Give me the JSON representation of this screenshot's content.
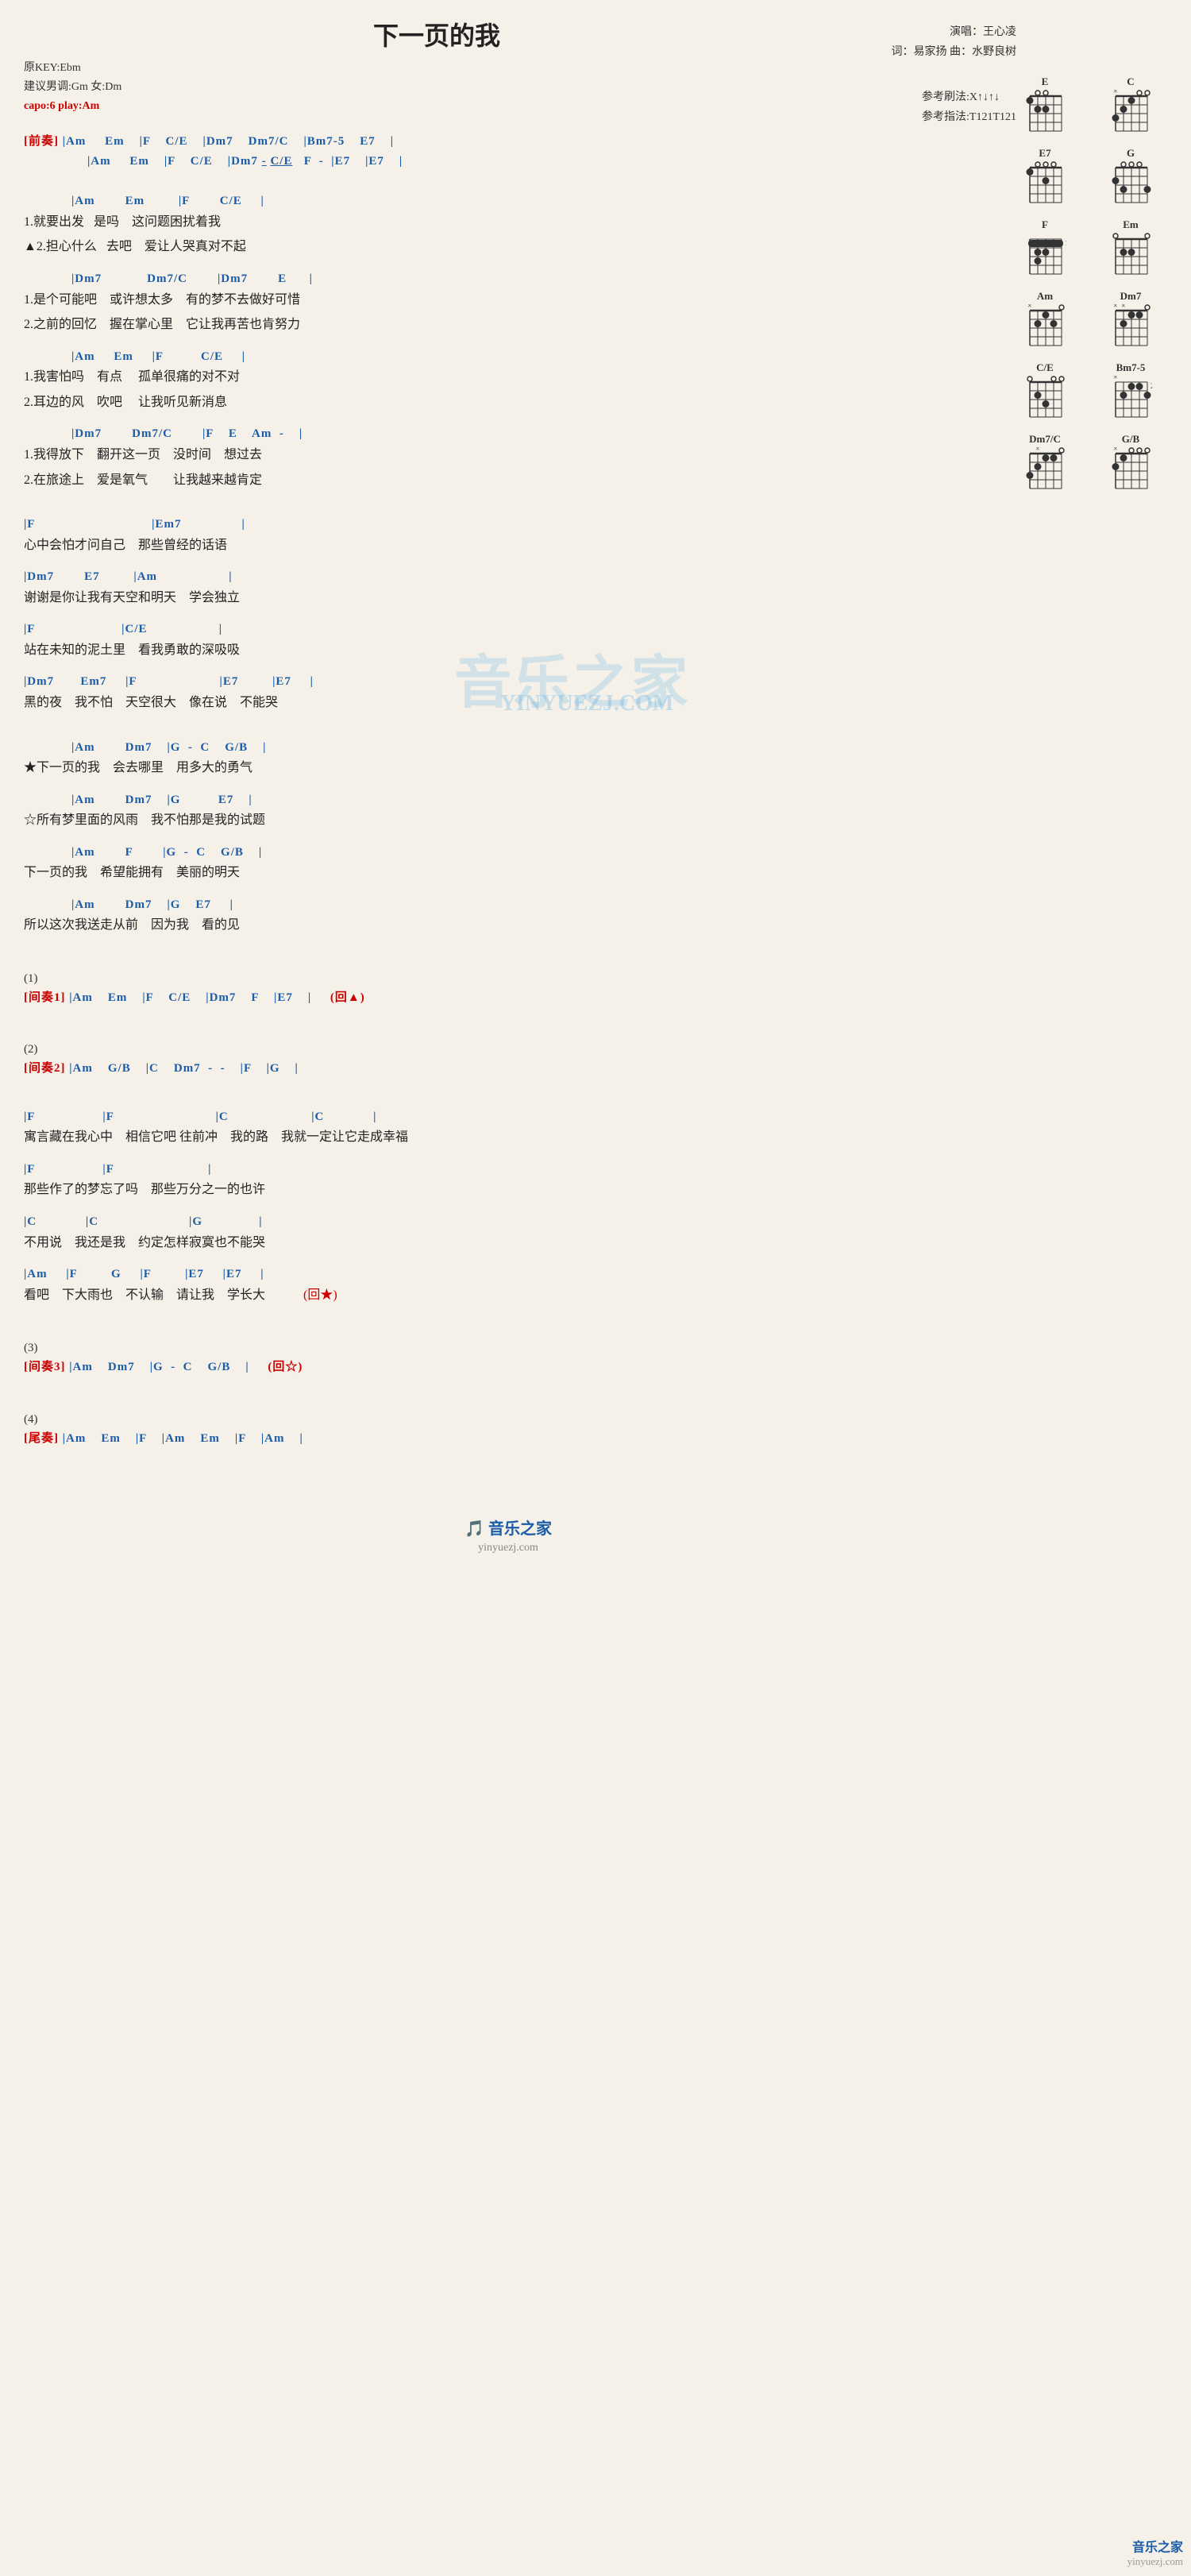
{
  "title": "下一页的我",
  "meta": {
    "original_key": "原KEY:Ebm",
    "suggested": "建议男调:Gm 女:Dm",
    "capo": "capo:6 play:Am",
    "artist_label": "演唱：王心凌",
    "lyrics_label": "词：易家扬  曲：水野良树"
  },
  "ref": {
    "strumming": "参考刷法:X↑↓↑↓",
    "fingering": "参考指法:T121T121"
  },
  "intro1_label": "前奏",
  "chords": {
    "diagrams": [
      {
        "name": "E",
        "pos": 0,
        "dots": [
          [
            1,
            1
          ],
          [
            2,
            2
          ],
          [
            3,
            2
          ]
        ]
      },
      {
        "name": "C",
        "pos": 0,
        "dots": [
          [
            1,
            1
          ],
          [
            2,
            2
          ],
          [
            3,
            3
          ]
        ]
      },
      {
        "name": "E7",
        "pos": 0,
        "dots": [
          [
            1,
            1
          ],
          [
            2,
            0
          ],
          [
            3,
            0
          ]
        ]
      },
      {
        "name": "G",
        "pos": 0,
        "dots": [
          [
            2,
            1
          ],
          [
            3,
            2
          ],
          [
            4,
            3
          ]
        ]
      },
      {
        "name": "F",
        "pos": 0,
        "dots": [
          [
            1,
            1
          ],
          [
            2,
            1
          ],
          [
            3,
            2
          ]
        ]
      },
      {
        "name": "Em",
        "pos": 0,
        "dots": [
          [
            2,
            2
          ],
          [
            3,
            2
          ]
        ]
      },
      {
        "name": "Am",
        "pos": 0,
        "dots": [
          [
            2,
            1
          ],
          [
            3,
            2
          ]
        ]
      },
      {
        "name": "Dm7",
        "pos": 0,
        "dots": [
          [
            1,
            1
          ],
          [
            2,
            1
          ],
          [
            3,
            2
          ]
        ]
      },
      {
        "name": "C/E",
        "pos": 0,
        "dots": [
          [
            2,
            2
          ],
          [
            3,
            3
          ]
        ]
      },
      {
        "name": "Bm7-5",
        "pos": 0,
        "dots": [
          [
            1,
            1
          ],
          [
            2,
            1
          ],
          [
            3,
            2
          ],
          [
            4,
            2
          ]
        ]
      },
      {
        "name": "Dm7/C",
        "pos": 0,
        "dots": [
          [
            1,
            1
          ],
          [
            2,
            1
          ],
          [
            3,
            2
          ]
        ]
      },
      {
        "name": "G/B",
        "pos": 0,
        "dots": [
          [
            1,
            2
          ],
          [
            2,
            0
          ],
          [
            3,
            0
          ]
        ]
      }
    ]
  },
  "sections": [
    {
      "id": "intro1",
      "chord_lines": [
        "|Am    Em    |F    C/E    |Dm7    Dm7/C    |Bm7-5    E7    |",
        "    |Am    Em    |F    C/E    |Dm7  -  C/E  F  -  |E7    |E7    |"
      ]
    },
    {
      "id": "verse1",
      "chord_line": "|Am        Em        |F        C/E    |",
      "lyric_lines": [
        "1.就要出发   是吗    这问题困扰着我",
        "▲2.担心什么   去吧    爱让人哭真对不起"
      ]
    },
    {
      "id": "verse2",
      "chord_line": "    |Dm7            Dm7/C        |Dm7        E    |",
      "lyric_lines": [
        "1.是个可能吧    或许想太多    有的梦不去做好可惜",
        "2.之前的回忆    握在掌心里    它让我再苦也肯努力"
      ]
    },
    {
      "id": "verse3",
      "chord_line": "    |Am    Em    |F        C/E    |",
      "lyric_lines": [
        "1.我害怕吗    有点    孤单很痛的对不对",
        "2.耳边的风    吹吧    让我听见新消息"
      ]
    },
    {
      "id": "verse4",
      "chord_line": "    |Dm7        Dm7/C        |F    E    Am  -  |",
      "lyric_lines": [
        "1.我得放下    翻开这一页    没时间    想过去",
        "2.在旅途上    爱是氧气        让我越来越肯定"
      ]
    },
    {
      "id": "chorus_pre",
      "chord_line": "|F                        |Em7            |",
      "lyric_lines": [
        "心中会怕才问自己    那些曾经的话语"
      ]
    },
    {
      "id": "chorus_pre2",
      "chord_line": "|Dm7        E7        |Am                |",
      "lyric_lines": [
        "谢谢是你让我有天空和明天    学会独立"
      ]
    },
    {
      "id": "chorus_pre3",
      "chord_line": "|F                    |C/E                |",
      "lyric_lines": [
        "站在未知的泥土里    看我勇敢的深吸吸"
      ]
    },
    {
      "id": "chorus_pre4",
      "chord_line": "|Dm7        Em7    |F                    |E7        |E7    |",
      "lyric_lines": [
        "黑的夜    我不怕    天空很大    像在说    不能哭"
      ]
    },
    {
      "id": "chorus_main",
      "chord_line": "    |Am        Dm7    |G  -  C    G/B    |",
      "lyric_lines": [
        "★下一页的我    会去哪里    用多大的勇气"
      ]
    },
    {
      "id": "chorus_main2",
      "chord_line": "    |Am        Dm7    |G        E7    |",
      "lyric_lines": [
        "☆所有梦里面的风雨    我不怕那是我的试题"
      ]
    },
    {
      "id": "chorus_main3",
      "chord_line": "    |Am        F        |G  -  C    G/B    |",
      "lyric_lines": [
        "下一页的我    希望能拥有    美丽的明天"
      ]
    },
    {
      "id": "chorus_main4",
      "chord_line": "    |Am        Dm7    |G    E7    |",
      "lyric_lines": [
        "所以这次我送走从前    因为我    看的见"
      ]
    },
    {
      "id": "section_1",
      "label": "(1)",
      "interlude": "[间奏1] |Am    Em    |F    C/E    |Dm7    F    |E7    |    (回▲)"
    },
    {
      "id": "section_2",
      "label": "(2)",
      "interlude": "[间奏2] |Am    G/B    |C    Dm7  -  -  |F    |G    |"
    },
    {
      "id": "bridge1",
      "chord_line": "|F                |F                        |C                    |C            |",
      "lyric_lines": [
        "寓言藏在我心中    相信它吧 往前冲    我的路    我就一定让它走成幸福"
      ]
    },
    {
      "id": "bridge2",
      "chord_line": "|F                |F                    |",
      "lyric_lines": [
        "那些作了的梦忘了吗    那些万分之一的也许"
      ]
    },
    {
      "id": "bridge3",
      "chord_line": "|C            |C                    |G            |",
      "lyric_lines": [
        "不用说    我还是我    约定怎样寂寞也不能哭"
      ]
    },
    {
      "id": "bridge4",
      "chord_line": "|Am    |F        G    |F        |E7    |E7    |",
      "lyric_lines": [
        "看吧    下大雨也    不认输    请让我    学长大        (回★)"
      ]
    },
    {
      "id": "section_3",
      "label": "(3)",
      "interlude": "[间奏3] |Am    Dm7    |G  -  C    G/B    |    (回☆)"
    },
    {
      "id": "section_4",
      "label": "(4)",
      "interlude": "[尾奏] |Am    Em    |F    |Am    Em    |F    |Am    |"
    }
  ],
  "footer": {
    "brand": "音乐之家",
    "url": "yinyuezj.com"
  }
}
